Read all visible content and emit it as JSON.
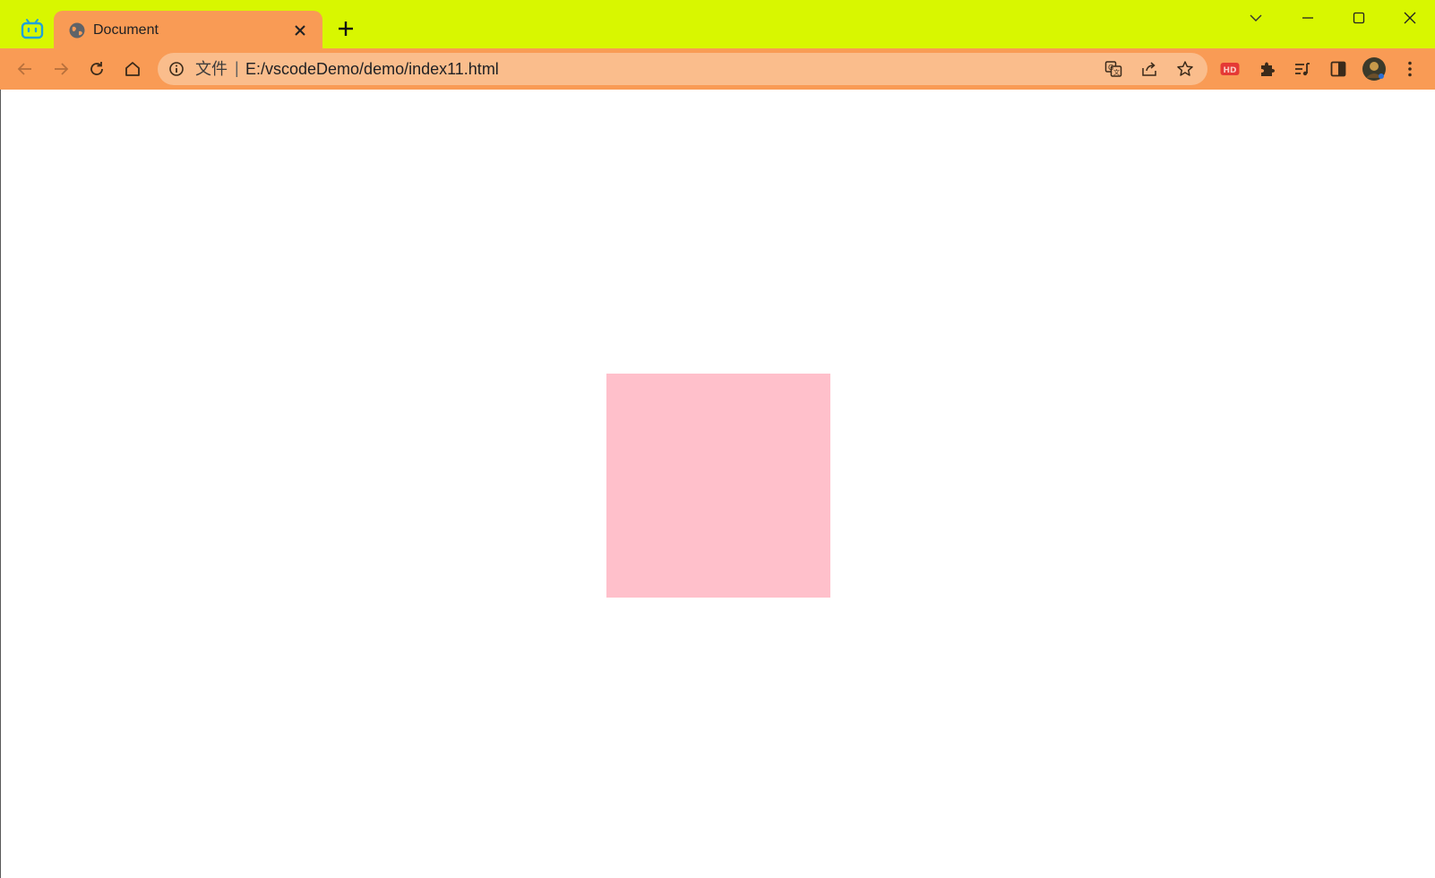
{
  "tab": {
    "title": "Document"
  },
  "address_bar": {
    "scheme_label": "文件",
    "separator": "|",
    "url": "E:/vscodeDemo/demo/index11.html"
  },
  "toolbar": {
    "hd_badge": "HD"
  },
  "colors": {
    "titlebar": "#d8f700",
    "tab_active": "#f99b55",
    "toolbar": "#f99b55",
    "omnibox": "#fabd8c",
    "pink_box": "#ffc0cb",
    "app_icon": "#1fa2d9",
    "hd_badge": "#e53935"
  },
  "icons": {
    "app": "bilibili-tv-icon",
    "tab_favicon": "globe-icon",
    "tab_close": "close-icon",
    "new_tab": "plus-icon",
    "tab_search": "chevron-down-icon",
    "minimize": "minimize-icon",
    "maximize": "maximize-icon",
    "close_window": "close-window-icon",
    "back": "back-arrow-icon",
    "forward": "forward-arrow-icon",
    "reload": "reload-icon",
    "home": "home-icon",
    "site_info": "info-icon",
    "translate": "translate-icon",
    "share": "share-icon",
    "bookmark": "star-icon",
    "extension_hd": "hd-extension-icon",
    "extensions": "puzzle-icon",
    "reading_list": "reading-list-icon",
    "side_panel": "side-panel-icon",
    "profile": "avatar-icon",
    "menu": "more-vertical-icon"
  }
}
